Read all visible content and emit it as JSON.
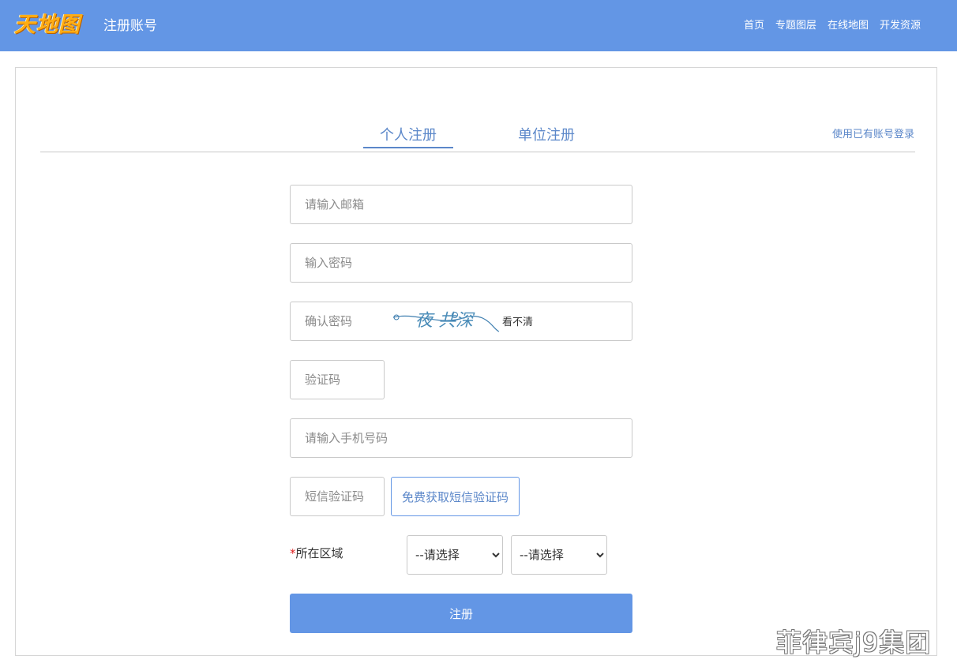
{
  "header": {
    "logo_text": "天地图",
    "page_title": "注册账号",
    "nav": [
      "首页",
      "专题图层",
      "在线地图",
      "开发资源"
    ]
  },
  "tabs": {
    "personal": "个人注册",
    "unit": "单位注册",
    "active": "个人注册"
  },
  "login_link": "使用已有账号登录",
  "form": {
    "email_placeholder": "请输入邮箱",
    "password_placeholder": "输入密码",
    "confirm_placeholder": "确认密码",
    "captcha_placeholder": "验证码",
    "captcha_text": "夜 共深",
    "captcha_refresh": "看不清",
    "phone_placeholder": "请输入手机号码",
    "sms_placeholder": "短信验证码",
    "sms_button": "免费获取短信验证码",
    "region_required_mark": "*",
    "region_label": "所在区域",
    "region_select_1": "--请选择",
    "region_select_2": "--请选择",
    "submit": "注册"
  },
  "watermark": "菲律宾j9集团",
  "colors": {
    "header_bg": "#6396e5",
    "accent_text": "#5b87c9",
    "logo": "#ffad14",
    "required": "#e02020"
  }
}
